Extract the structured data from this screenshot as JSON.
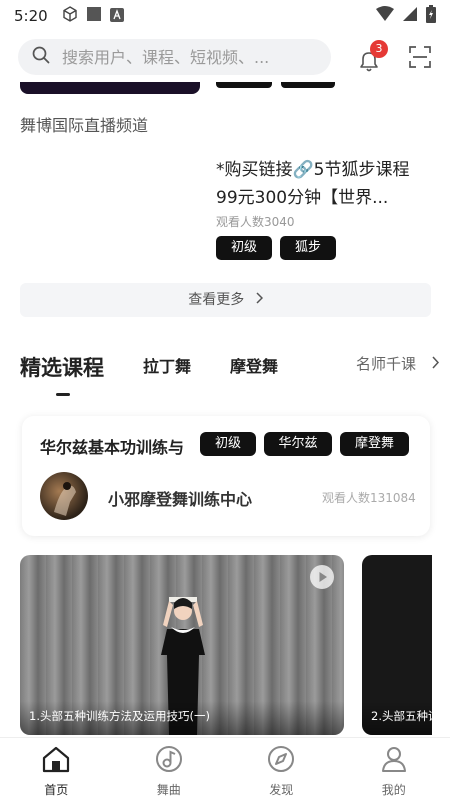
{
  "status_bar": {
    "time": "5:20"
  },
  "search": {
    "placeholder": "搜索用户、课程、短视频、...",
    "notification_count": "3"
  },
  "channel": {
    "label": "舞博国际直播频道"
  },
  "course": {
    "title": "*购买链接🔗5节狐步课程99元300分钟【世界...",
    "views": "观看人数3040",
    "tags": [
      "初级",
      "狐步"
    ]
  },
  "see_more": {
    "label": "查看更多"
  },
  "section_tabs": {
    "active": "精选课程",
    "tabs": [
      "拉丁舞",
      "摩登舞"
    ],
    "more": "名师千课"
  },
  "featured": {
    "title": "华尔兹基本功训练与",
    "tags": [
      "初级",
      "华尔兹",
      "摩登舞"
    ],
    "org_name": "小邪摩登舞训练中心",
    "views": "观看人数131084"
  },
  "videos": [
    {
      "caption": "1.头部五种训练方法及运用技巧(一)"
    },
    {
      "caption": "2.头部五种训"
    }
  ],
  "bottom_nav": [
    {
      "label": "首页",
      "icon": "home-icon",
      "active": true
    },
    {
      "label": "舞曲",
      "icon": "music-icon",
      "active": false
    },
    {
      "label": "发现",
      "icon": "compass-icon",
      "active": false
    },
    {
      "label": "我的",
      "icon": "profile-icon",
      "active": false
    }
  ]
}
